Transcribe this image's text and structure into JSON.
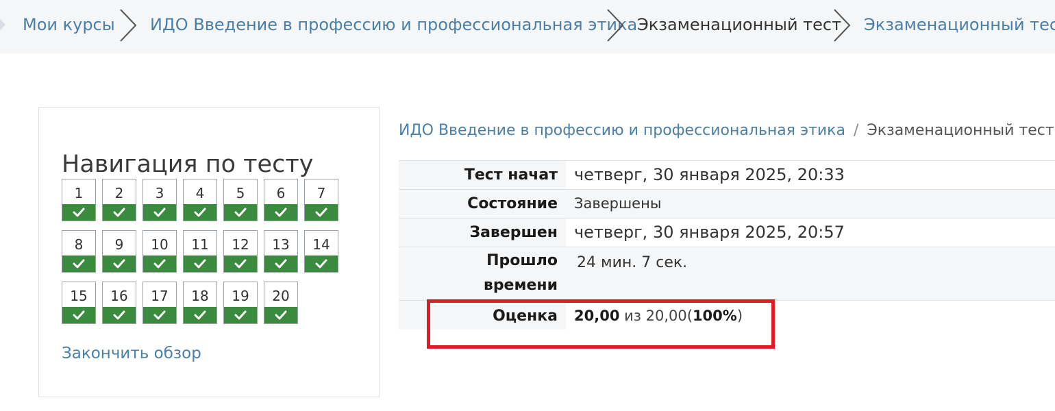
{
  "breadcrumb": {
    "items": [
      {
        "label": "Мои курсы",
        "link": true
      },
      {
        "label": "ИДО Введение в профессию и профессиональная этика",
        "link": true
      },
      {
        "label": "Экзаменационный тест",
        "link": false
      },
      {
        "label": "Экзаменационный тест",
        "link": true
      }
    ]
  },
  "quiz_nav": {
    "title": "Навигация по тесту",
    "questions": [
      "1",
      "2",
      "3",
      "4",
      "5",
      "6",
      "7",
      "8",
      "9",
      "10",
      "11",
      "12",
      "13",
      "14",
      "15",
      "16",
      "17",
      "18",
      "19",
      "20"
    ],
    "state": "answered",
    "check_color": "#3a8b3d",
    "finish_review": "Закончить обзор"
  },
  "page_path": {
    "course": "ИДО Введение в профессию и профессиональная этика",
    "divider": "/",
    "current": "Экзаменационный тест"
  },
  "summary": {
    "started_label": "Тест начат",
    "started_value": "четверг, 30 января 2025, 20:33",
    "state_label": "Состояние",
    "state_value": "Завершены",
    "completed_label": "Завершен",
    "completed_value": "четверг, 30 января 2025, 20:57",
    "time_label_1": "Прошло",
    "time_label_2": "времени",
    "time_value": "24 мин. 7 сек.",
    "grade_label": "Оценка",
    "grade_score": "20,00",
    "grade_of": "из 20,00",
    "grade_paren_open": "(",
    "grade_percent": "100%",
    "grade_paren_close": ")"
  },
  "highlight_color": "#e01b24"
}
